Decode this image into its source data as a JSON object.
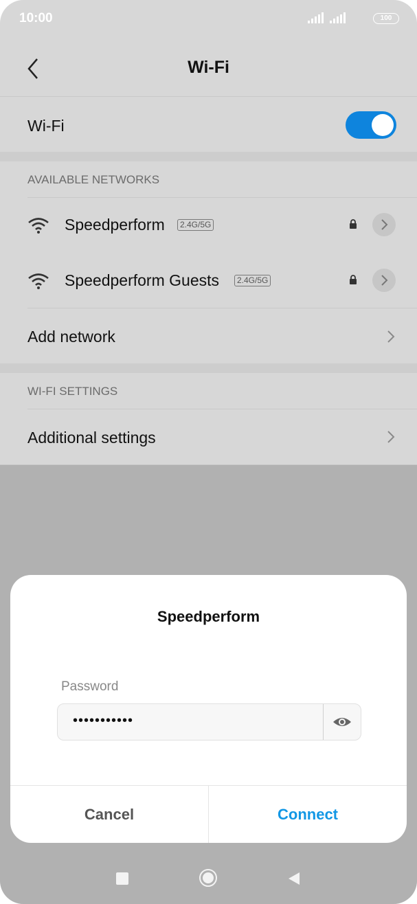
{
  "status_bar": {
    "time": "10:00",
    "battery": "100",
    "icons": [
      "signal-icon",
      "signal-icon",
      "battery-icon"
    ]
  },
  "header": {
    "title": "Wi-Fi",
    "back_icon": "chevron-left-icon"
  },
  "wifi_toggle": {
    "label": "Wi-Fi",
    "state": "on",
    "color": "#0e84dd"
  },
  "available_networks": {
    "section_title": "AVAILABLE NETWORKS",
    "networks": [
      {
        "name": "Speedperform",
        "band": "2.4G/5G",
        "icon": "wifi-icon",
        "secured": true
      },
      {
        "name": "Speedperform Guests",
        "band": "2.4G/5G",
        "icon": "wifi-icon",
        "secured": true
      }
    ],
    "add_network_label": "Add network"
  },
  "wifi_settings": {
    "section_title": "WI-FI SETTINGS",
    "additional_settings_label": "Additional settings"
  },
  "dialog": {
    "title": "Speedperform",
    "password_label": "Password",
    "password_value": "•••••••••••",
    "cancel_label": "Cancel",
    "connect_label": "Connect",
    "accent_color": "#1297e5"
  },
  "nav_bar": {
    "icons": [
      "recents-square-icon",
      "home-circle-icon",
      "back-triangle-icon"
    ]
  }
}
